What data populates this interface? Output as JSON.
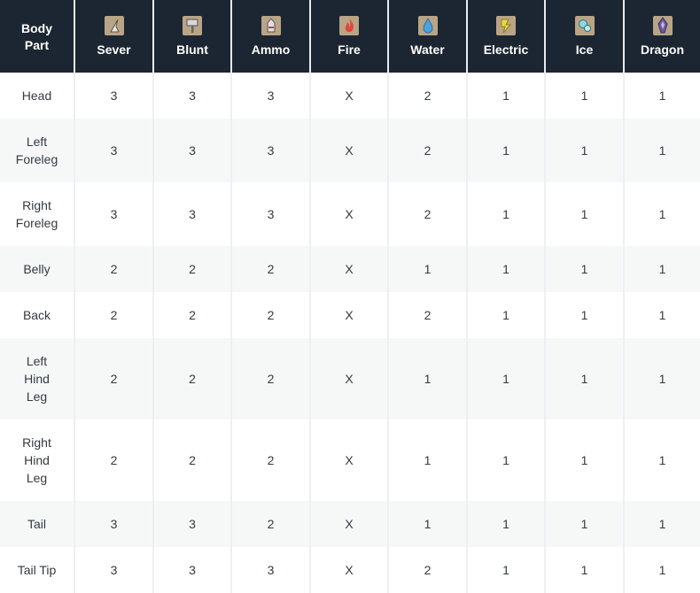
{
  "header": {
    "body_part_lines": [
      "Body",
      "Part"
    ],
    "columns": [
      {
        "label": "Sever",
        "icon": "sever-icon"
      },
      {
        "label": "Blunt",
        "icon": "blunt-icon"
      },
      {
        "label": "Ammo",
        "icon": "ammo-icon"
      },
      {
        "label": "Fire",
        "icon": "fire-icon"
      },
      {
        "label": "Water",
        "icon": "water-icon"
      },
      {
        "label": "Electric",
        "icon": "electric-icon"
      },
      {
        "label": "Ice",
        "icon": "ice-icon"
      },
      {
        "label": "Dragon",
        "icon": "dragon-icon"
      }
    ]
  },
  "rows": [
    {
      "part_lines": [
        "Head"
      ],
      "values": [
        "3",
        "3",
        "3",
        "X",
        "2",
        "1",
        "1",
        "1"
      ]
    },
    {
      "part_lines": [
        "Left",
        "Foreleg"
      ],
      "values": [
        "3",
        "3",
        "3",
        "X",
        "2",
        "1",
        "1",
        "1"
      ]
    },
    {
      "part_lines": [
        "Right",
        "Foreleg"
      ],
      "values": [
        "3",
        "3",
        "3",
        "X",
        "2",
        "1",
        "1",
        "1"
      ]
    },
    {
      "part_lines": [
        "Belly"
      ],
      "values": [
        "2",
        "2",
        "2",
        "X",
        "1",
        "1",
        "1",
        "1"
      ]
    },
    {
      "part_lines": [
        "Back"
      ],
      "values": [
        "2",
        "2",
        "2",
        "X",
        "2",
        "1",
        "1",
        "1"
      ]
    },
    {
      "part_lines": [
        "Left",
        "Hind",
        "Leg"
      ],
      "values": [
        "2",
        "2",
        "2",
        "X",
        "1",
        "1",
        "1",
        "1"
      ]
    },
    {
      "part_lines": [
        "Right",
        "Hind",
        "Leg"
      ],
      "values": [
        "2",
        "2",
        "2",
        "X",
        "1",
        "1",
        "1",
        "1"
      ]
    },
    {
      "part_lines": [
        "Tail"
      ],
      "values": [
        "3",
        "3",
        "2",
        "X",
        "1",
        "1",
        "1",
        "1"
      ]
    },
    {
      "part_lines": [
        "Tail Tip"
      ],
      "values": [
        "3",
        "3",
        "3",
        "X",
        "2",
        "1",
        "1",
        "1"
      ]
    }
  ]
}
